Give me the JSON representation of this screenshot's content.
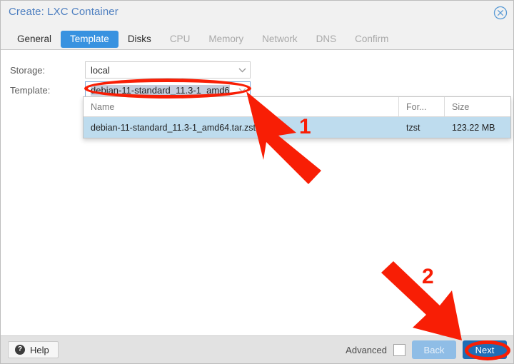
{
  "window": {
    "title": "Create: LXC Container",
    "close_icon": "close-circle-icon"
  },
  "tabs": [
    {
      "label": "General",
      "state": "enabled"
    },
    {
      "label": "Template",
      "state": "active"
    },
    {
      "label": "Disks",
      "state": "enabled"
    },
    {
      "label": "CPU",
      "state": "disabled"
    },
    {
      "label": "Memory",
      "state": "disabled"
    },
    {
      "label": "Network",
      "state": "disabled"
    },
    {
      "label": "DNS",
      "state": "disabled"
    },
    {
      "label": "Confirm",
      "state": "disabled"
    }
  ],
  "form": {
    "storage": {
      "label": "Storage:",
      "value": "local",
      "chevron_icon": "chevron-down-icon"
    },
    "template": {
      "label": "Template:",
      "value": "debian-11-standard_11.3-1_amd6",
      "chevron_icon": "chevron-down-icon"
    }
  },
  "dropdown": {
    "columns": [
      "Name",
      "For...",
      "Size"
    ],
    "rows": [
      {
        "name": "debian-11-standard_11.3-1_amd64.tar.zst",
        "format": "tzst",
        "size": "123.22 MB",
        "selected": true
      }
    ]
  },
  "footer": {
    "help_label": "Help",
    "help_icon": "question-circle-icon",
    "advanced_label": "Advanced",
    "advanced_checked": false,
    "back_label": "Back",
    "back_enabled": false,
    "next_label": "Next",
    "next_enabled": true
  },
  "annotations": {
    "step1_label": "1",
    "step2_label": "2",
    "highlight_color": "#f81e05",
    "arrow_color": "#f81e05"
  },
  "colors": {
    "accent_blue": "#3892e0",
    "title_blue": "#4e7fc0",
    "next_blue": "#1f6db5",
    "back_blue": "#8fbde6",
    "row_highlight": "#bedcee",
    "text_selection": "#c5cedd",
    "header_bg": "#f1f1f1",
    "footer_bg": "#e2e2e2"
  }
}
